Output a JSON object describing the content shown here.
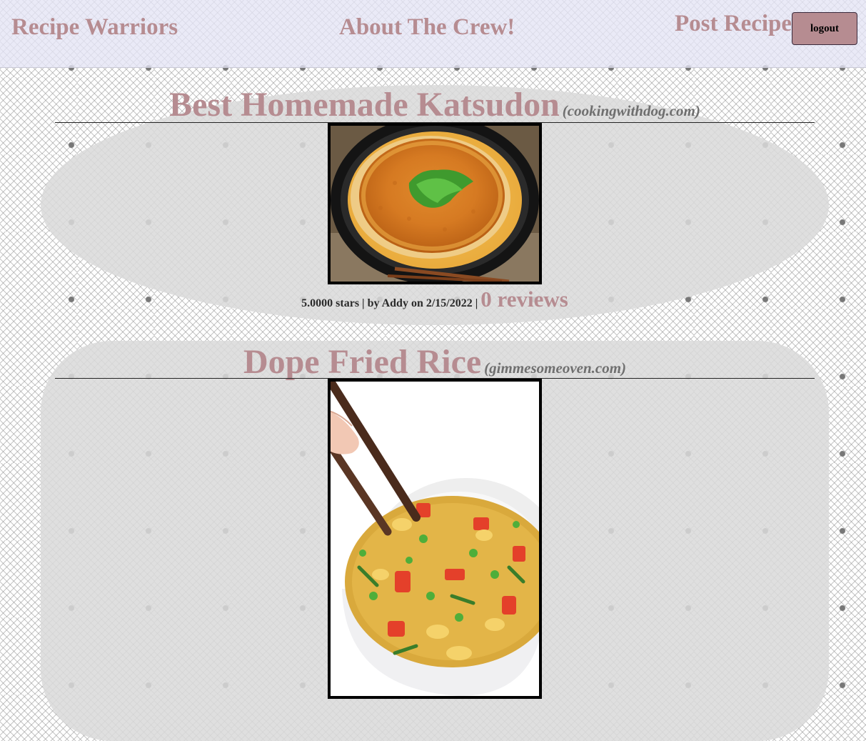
{
  "nav": {
    "brand": "Recipe Warriors",
    "about": "About The Crew!",
    "post": "Post Recipe",
    "logout": "logout"
  },
  "recipes": [
    {
      "title": "Best Homemade Katsudon",
      "source": "(cookingwithdog.com)",
      "meta": "5.0000 stars | by Addy on 2/15/2022 |",
      "reviews": "0 reviews",
      "image_alt": "katsudon bowl photo"
    },
    {
      "title": "Dope Fried Rice",
      "source": "(gimmesomeoven.com)",
      "image_alt": "fried rice bowl photo"
    }
  ],
  "colors": {
    "accent": "#b68c91",
    "navbar": "#e4e4f5",
    "card": "#dadada",
    "source_text": "#6f6f6f"
  }
}
